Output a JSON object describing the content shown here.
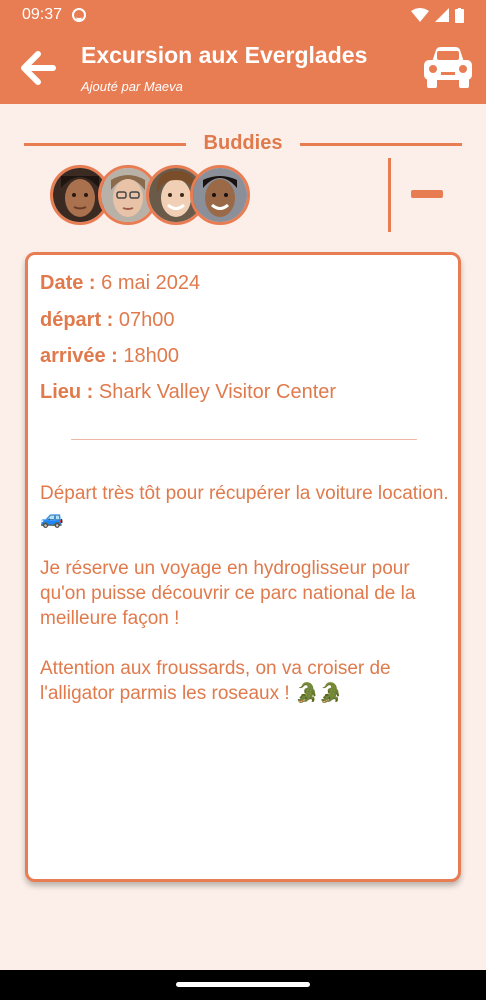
{
  "status_bar": {
    "time": "09:37"
  },
  "app_bar": {
    "title": "Excursion aux Everglades",
    "subtitle": "Ajouté par Maeva",
    "back_icon": "arrow-left-icon",
    "car_icon": "car-icon"
  },
  "buddies": {
    "title": "Buddies",
    "avatars": [
      {
        "name": "buddy-1"
      },
      {
        "name": "buddy-2"
      },
      {
        "name": "buddy-3"
      },
      {
        "name": "buddy-4"
      }
    ]
  },
  "details": {
    "date_label": "Date :",
    "date_value": "6 mai 2024",
    "depart_label": "départ :",
    "depart_value": "07h00",
    "arrivee_label": "arrivée :",
    "arrivee_value": "18h00",
    "lieu_label": "Lieu :",
    "lieu_value": "Shark Valley Visitor Center"
  },
  "description": {
    "p1": "Départ très tôt pour récupérer la voiture location. 🚙",
    "p2": "Je réserve un voyage en hydroglisseur pour qu'on puisse découvrir ce parc national de la meilleure façon !",
    "p3": "Attention aux froussards, on va croiser de l'alligator parmis les roseaux ! 🐊🐊"
  },
  "colors": {
    "primary": "#e87c53",
    "text": "#e07a4c",
    "background": "#fcefe9"
  }
}
